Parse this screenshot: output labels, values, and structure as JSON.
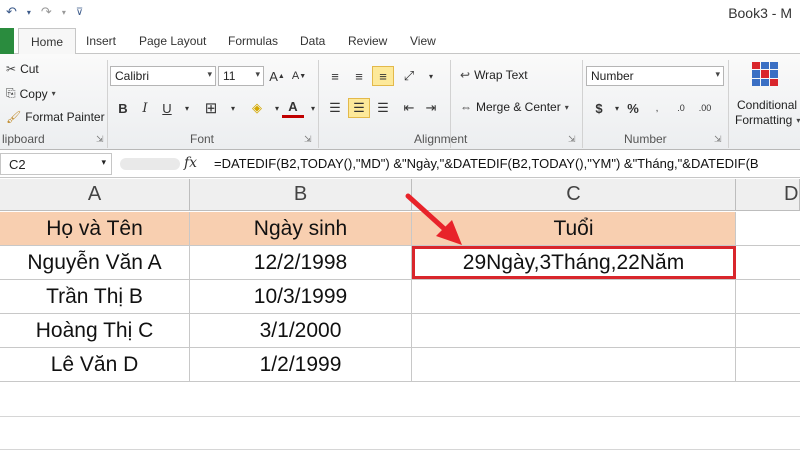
{
  "window": {
    "title": "Book3 - M"
  },
  "qat": {
    "undo_icon": "undo-icon",
    "redo_icon": "redo-icon"
  },
  "tabs": [
    {
      "label": "Home"
    },
    {
      "label": "Insert"
    },
    {
      "label": "Page Layout"
    },
    {
      "label": "Formulas"
    },
    {
      "label": "Data"
    },
    {
      "label": "Review"
    },
    {
      "label": "View"
    }
  ],
  "ribbon": {
    "clipboard": {
      "cut": "Cut",
      "copy": "Copy",
      "format_painter": "Format Painter",
      "label": "lipboard"
    },
    "font": {
      "name": "Calibri",
      "size": "11",
      "bold": "B",
      "italic": "I",
      "underline": "U",
      "label": "Font",
      "font_color_letter": "A",
      "accent": "#c00000"
    },
    "alignment": {
      "wrap_text": "Wrap Text",
      "merge_center": "Merge & Center",
      "label": "Alignment"
    },
    "number": {
      "format": "Number",
      "label": "Number",
      "currency": "$",
      "percent": "%"
    },
    "styles": {
      "conditional": "Conditional",
      "formatting": "Formatting"
    }
  },
  "formula_bar": {
    "name_box": "C2",
    "fx": "fx",
    "formula": "=DATEDIF(B2,TODAY(),\"MD\") &\"Ngày,\"&DATEDIF(B2,TODAY(),\"YM\") &\"Tháng,\"&DATEDIF(B"
  },
  "sheet": {
    "columns": [
      "A",
      "B",
      "C",
      "D"
    ],
    "header": [
      "Họ và Tên",
      "Ngày sinh",
      "Tuổi"
    ],
    "rows": [
      [
        "Nguyễn Văn A",
        "12/2/1998",
        "29Ngày,3Tháng,22Năm"
      ],
      [
        "Trần Thị B",
        "10/3/1999",
        ""
      ],
      [
        "Hoàng Thị C",
        "3/1/2000",
        ""
      ],
      [
        "Lê Văn D",
        "1/2/1999",
        ""
      ]
    ],
    "header_fill": "#f8cfb0",
    "highlight_color": "#d9262c"
  }
}
